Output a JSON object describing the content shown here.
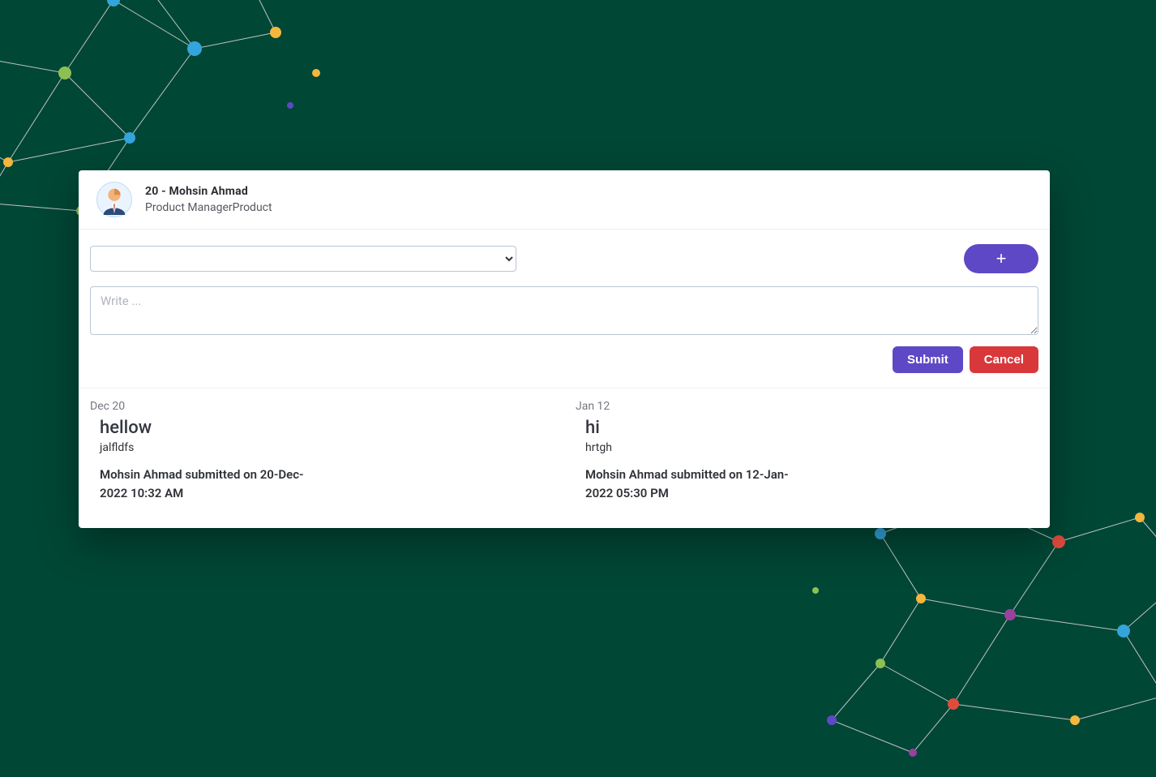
{
  "header": {
    "title": "20 - Mohsin Ahmad",
    "subtitle": "Product ManagerProduct"
  },
  "form": {
    "select_value": "",
    "add_label": "+",
    "write_placeholder": "Write ...",
    "submit_label": "Submit",
    "cancel_label": "Cancel"
  },
  "entries": [
    {
      "date": "Dec 20",
      "heading": "hellow",
      "body": "jalfldfs",
      "meta": "Mohsin Ahmad submitted on 20-Dec-2022 10:32 AM"
    },
    {
      "date": "Jan 12",
      "heading": "hi",
      "body": "hrtgh",
      "meta": "Mohsin Ahmad submitted on 12-Jan-2022 05:30 PM"
    }
  ],
  "colors": {
    "background": "#004735",
    "accent": "#5e48c6",
    "danger": "#d9383b"
  }
}
